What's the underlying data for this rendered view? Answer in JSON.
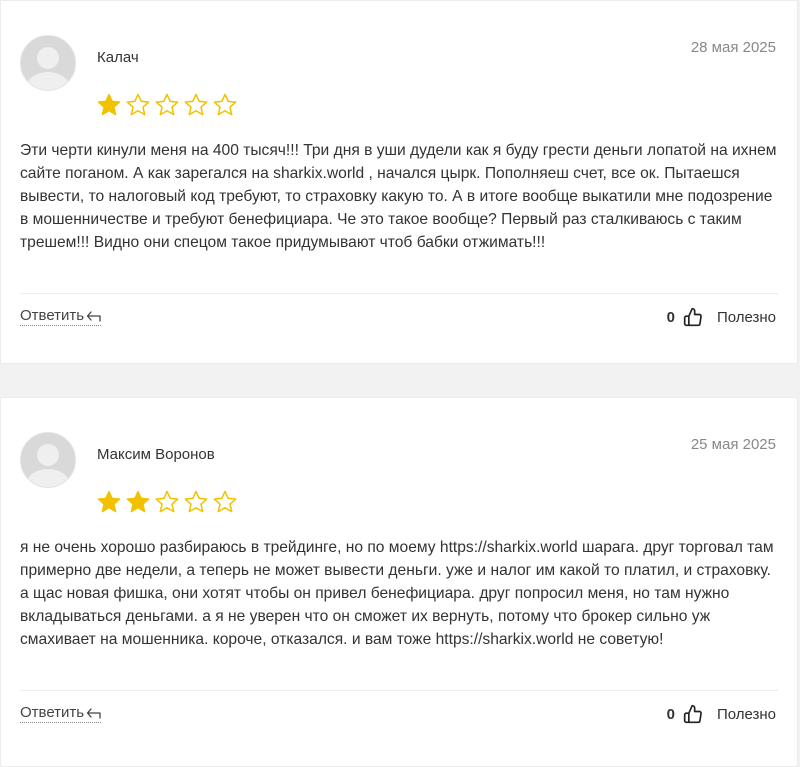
{
  "colors": {
    "star_filled": "#f2c200",
    "star_outline": "#f2c200",
    "date": "#888888",
    "divider": "#ececec"
  },
  "reviews": [
    {
      "author": "Калач",
      "date": "28 мая 2025",
      "rating": 1,
      "max_rating": 5,
      "text": "Эти черти кинули меня на 400 тысяч!!! Три дня в уши дудели как я буду грести деньги лопатой на ихнем сайте поганом. А как зарегался на sharkix.world , начался цырк. Пополняеш счет, все ок. Пытаешся вывести, то налоговый код требуют, то страховку какую то. А в итоге вообще выкатили мне подозрение в мошенничестве и требуют бенефициара. Че это такое вообще? Первый раз сталкиваюсь с таким трешем!!! Видно они спецом такое придумывают чтоб бабки отжимать!!!",
      "reply_label": "Ответить",
      "reply_icon": "↵",
      "likes": "0",
      "useful_label": "Полезно"
    },
    {
      "author": "Максим Воронов",
      "date": "25 мая 2025",
      "rating": 2,
      "max_rating": 5,
      "text": "я не очень хорошо разбираюсь в трейдинге, но по моему https://sharkix.world шарага. друг торговал там примерно две недели, а теперь не может вывести деньги. уже и налог им какой то платил, и страховку. а щас новая фишка, они хотят чтобы он привел бенефициара. друг попросил меня, но там нужно вкладываться деньгами. а я не уверен что он сможет их вернуть, потому что брокер сильно уж смахивает на мошенника. короче, отказался. и вам тоже https://sharkix.world не советую!",
      "reply_label": "Ответить",
      "reply_icon": "↵",
      "likes": "0",
      "useful_label": "Полезно"
    }
  ]
}
